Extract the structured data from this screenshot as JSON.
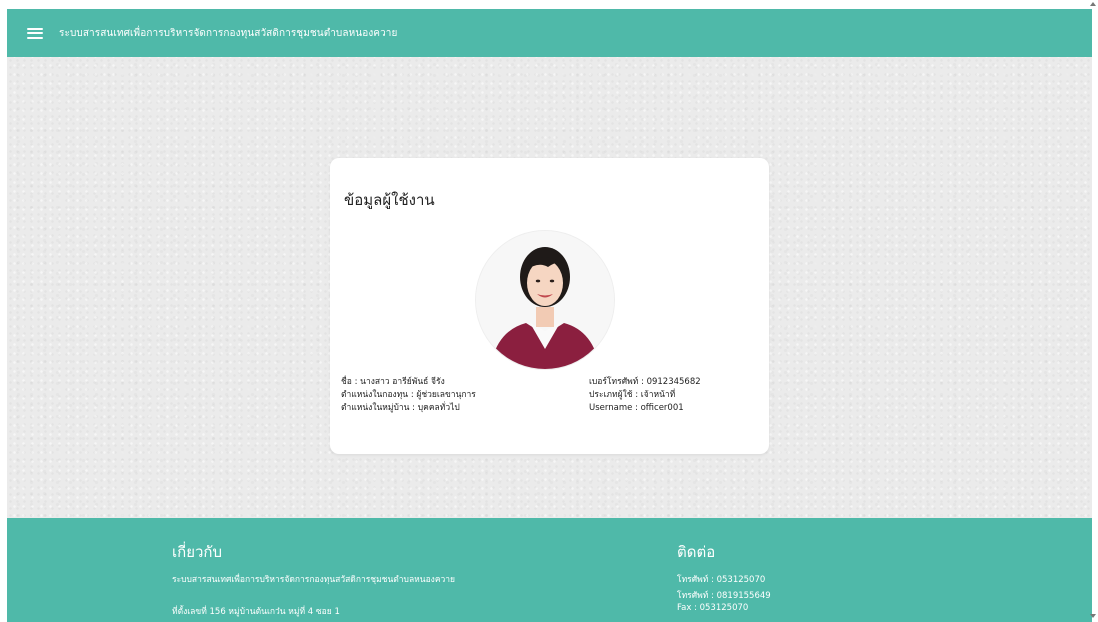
{
  "header": {
    "menu_icon": "hamburger-menu-icon",
    "title": "ระบบสารสนเทศเพื่อการบริหารจัดการกองทุนสวัสดิการชุมชนตำบลหนองควาย"
  },
  "profile": {
    "title": "ข้อมูลผู้ใช้งาน",
    "avatar_icon": "user-photo",
    "left": [
      "ชื่อ : นางสาว อารีย์พันธ์ จีรัง",
      "ตำแหน่งในกองทุน : ผู้ช่วยเลขานุการ",
      "ตำแหน่งในหมู่บ้าน : บุคคลทั่วไป"
    ],
    "right": [
      "เบอร์โทรศัพท์ : 0912345682",
      "ประเภทผู้ใช้ : เจ้าหน้าที่",
      "Username : officer001"
    ]
  },
  "footer": {
    "about_title": "เกี่ยวกับ",
    "about_text": "ระบบสารสนเทศเพื่อการบริหารจัดการกองทุนสวัสดิการชุมชนตำบลหนองควาย",
    "address": "ที่ตั้งเลขที่ 156 หมู่บ้านต้นเกว๋น หมู่ที่ 4 ซอย 1",
    "contact_title": "ติดต่อ",
    "phone1": "โทรศัพท์ : 053125070",
    "phone2": "โทรศัพท์ : 0819155649",
    "fax": "Fax : 053125070"
  },
  "colors": {
    "accent": "#4fb9a9",
    "background": "#ebebeb",
    "card": "#ffffff"
  }
}
